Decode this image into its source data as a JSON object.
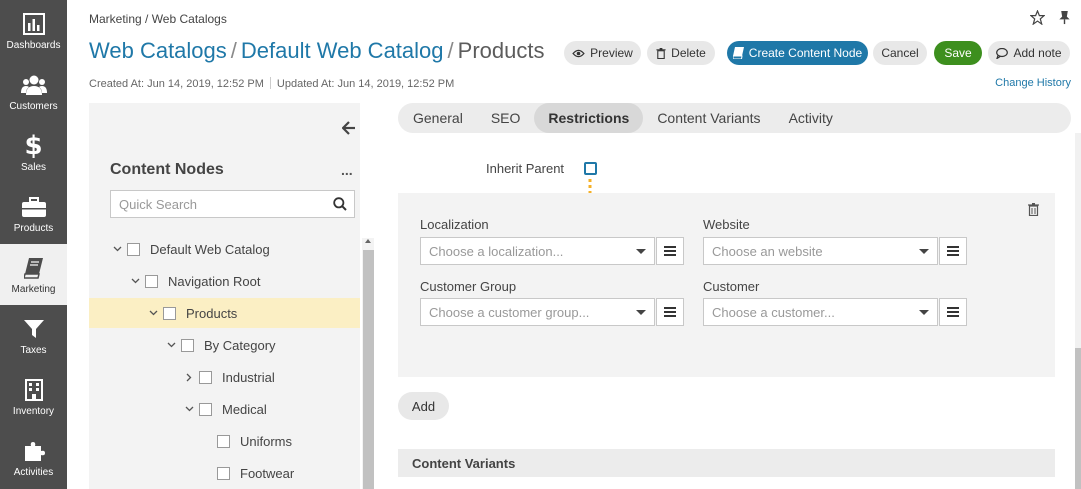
{
  "nav": [
    {
      "label": "Dashboards",
      "icon": "bar-chart-icon"
    },
    {
      "label": "Customers",
      "icon": "users-icon"
    },
    {
      "label": "Sales",
      "icon": "dollar-icon"
    },
    {
      "label": "Products",
      "icon": "briefcase-icon"
    },
    {
      "label": "Marketing",
      "icon": "book-icon"
    },
    {
      "label": "Taxes",
      "icon": "funnel-icon"
    },
    {
      "label": "Inventory",
      "icon": "building-icon"
    },
    {
      "label": "Activities",
      "icon": "puzzle-icon"
    }
  ],
  "breadcrumb": "Marketing / Web Catalogs",
  "title": {
    "part1": "Web Catalogs",
    "sep": "/",
    "part2": "Default Web Catalog",
    "part3": "Products"
  },
  "meta": {
    "created": "Created At: Jun 14, 2019, 12:52 PM",
    "updated": "Updated At: Jun 14, 2019, 12:52 PM"
  },
  "change_history": "Change History",
  "buttons": {
    "preview": "Preview",
    "delete": "Delete",
    "create": "Create Content Node",
    "cancel": "Cancel",
    "save": "Save",
    "add_note": "Add note"
  },
  "sidebar": {
    "title": "Content Nodes",
    "more": "...",
    "search_placeholder": "Quick Search",
    "tree": [
      {
        "label": "Default Web Catalog"
      },
      {
        "label": "Navigation Root"
      },
      {
        "label": "Products"
      },
      {
        "label": "By Category"
      },
      {
        "label": "Industrial"
      },
      {
        "label": "Medical"
      },
      {
        "label": "Uniforms"
      },
      {
        "label": "Footwear"
      }
    ]
  },
  "tabs": [
    "General",
    "SEO",
    "Restrictions",
    "Content Variants",
    "Activity"
  ],
  "active_tab": "Restrictions",
  "inherit_parent": "Inherit Parent",
  "restrictions": {
    "localization_label": "Localization",
    "localization_placeholder": "Choose a localization...",
    "website_label": "Website",
    "website_placeholder": "Choose an website",
    "customer_group_label": "Customer Group",
    "customer_group_placeholder": "Choose a customer group...",
    "customer_label": "Customer",
    "customer_placeholder": "Choose a customer..."
  },
  "add_label": "Add",
  "content_variants_title": "Content Variants",
  "colors": {
    "accent": "#1f78a8",
    "save": "#3d8f1e",
    "nav_bg": "#4d4d4d",
    "selected_row": "#fbefc4",
    "arrow": "#f5b027"
  }
}
